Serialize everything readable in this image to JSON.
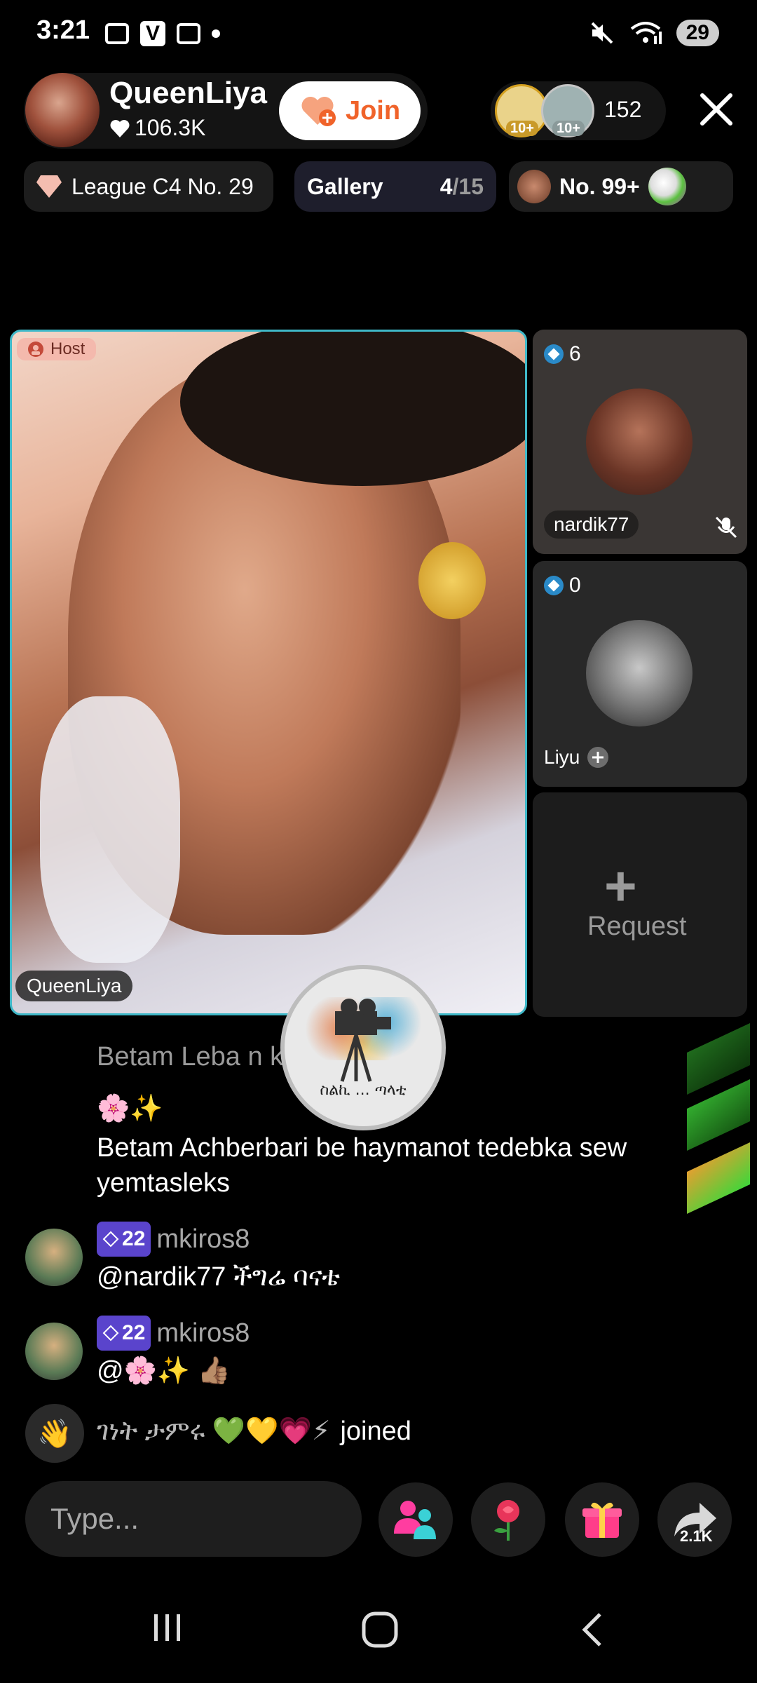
{
  "status_bar": {
    "time": "3:21",
    "v_icon": "V",
    "battery": "29"
  },
  "header": {
    "host_name": "QueenLiya",
    "host_likes": "106.3K",
    "join_label": "Join",
    "viewer_badge_1": "10+",
    "viewer_badge_2": "10+",
    "viewer_count": "152"
  },
  "chips": {
    "league": "League C4 No. 29",
    "gallery_label": "Gallery",
    "gallery_current": "4",
    "gallery_total": "/15",
    "rank": "No. 99+"
  },
  "stage": {
    "host_tag": "Host",
    "host_video_name": "QueenLiya",
    "guests": [
      {
        "count": "6",
        "name": "nardik77"
      },
      {
        "count": "0",
        "name": "Liyu"
      }
    ],
    "request_plus": "+",
    "request_label": "Request",
    "center_badge_text": "ስልኪ ... ጣላቲ"
  },
  "chat": {
    "line1": "Betam Leba n                    ke balua",
    "line2_emojis": "🌸✨",
    "line2_text": "Betam Achberbari be haymanot tedebka sew yemtasleks",
    "msg1_level": "22",
    "msg1_user": "mkiros8",
    "msg1_text": "@nardik77 ችግሬ ባናቴ",
    "msg2_level": "22",
    "msg2_user": "mkiros8",
    "msg2_text": "@🌸✨ 👍🏽",
    "join_name": "ገነት ታምሩ 💚💛💗⚡",
    "join_suffix": "joined"
  },
  "bottom_bar": {
    "type_placeholder": "Type...",
    "share_count": "2.1K"
  },
  "colors": {
    "accent_join": "#f0632a",
    "host_border": "#3fb8c8",
    "level_purple": "#5a44cc"
  }
}
